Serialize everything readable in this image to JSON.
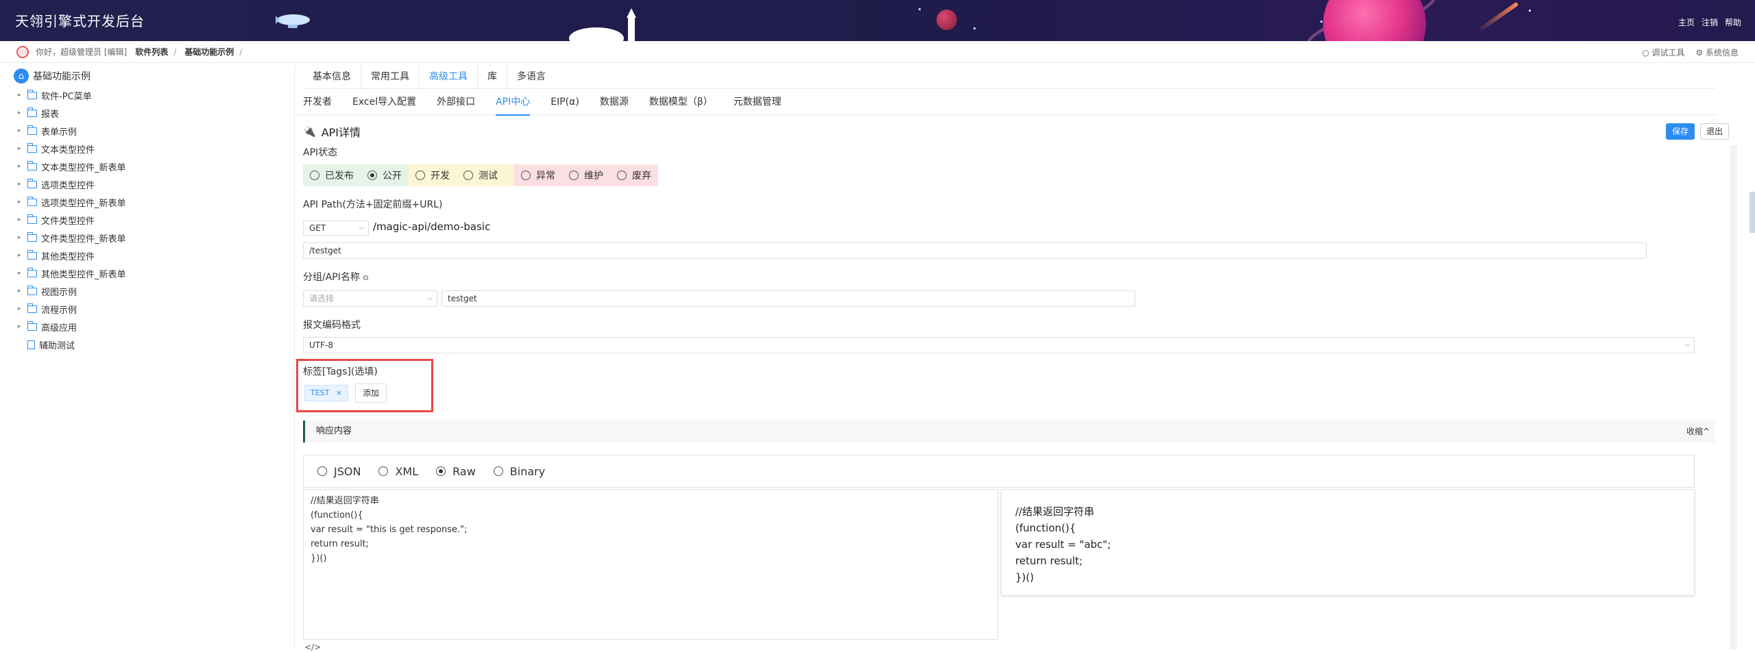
{
  "header": {
    "title": "天翎引擎式开发后台",
    "nav": [
      "主页",
      "注销",
      "帮助"
    ]
  },
  "breadcrumb": {
    "greeting": "你好，超级管理员 [编辑]",
    "items": [
      "软件列表",
      "基础功能示例"
    ],
    "separator": "/",
    "tools": [
      "调试工具",
      "系统信息"
    ]
  },
  "sidebar": {
    "root": "基础功能示例",
    "items": [
      {
        "label": "软件-PC菜单",
        "type": "folder"
      },
      {
        "label": "报表",
        "type": "folder"
      },
      {
        "label": "表单示例",
        "type": "folder"
      },
      {
        "label": "文本类型控件",
        "type": "folder"
      },
      {
        "label": "文本类型控件_新表单",
        "type": "folder"
      },
      {
        "label": "选项类型控件",
        "type": "folder"
      },
      {
        "label": "选项类型控件_新表单",
        "type": "folder"
      },
      {
        "label": "文件类型控件",
        "type": "folder"
      },
      {
        "label": "文件类型控件_新表单",
        "type": "folder"
      },
      {
        "label": "其他类型控件",
        "type": "folder"
      },
      {
        "label": "其他类型控件_新表单",
        "type": "folder"
      },
      {
        "label": "视图示例",
        "type": "folder"
      },
      {
        "label": "流程示例",
        "type": "folder"
      },
      {
        "label": "高级应用",
        "type": "folder"
      },
      {
        "label": "辅助测试",
        "type": "file"
      }
    ]
  },
  "tabs_primary": {
    "items": [
      "基本信息",
      "常用工具",
      "高级工具",
      "库",
      "多语言"
    ],
    "active": "高级工具"
  },
  "tabs_secondary": {
    "items": [
      "开发者",
      "Excel导入配置",
      "外部接口",
      "API中心",
      "EIP(α)",
      "数据源",
      "数据模型（β）",
      "元数据管理"
    ],
    "active": "API中心"
  },
  "detail": {
    "title": "API详情",
    "save": "保存",
    "exit": "退出",
    "status_label": "API状态",
    "statuses": [
      {
        "label": "已发布",
        "selected": false,
        "group": "green"
      },
      {
        "label": "公开",
        "selected": true,
        "group": "green"
      },
      {
        "label": "开发",
        "selected": false,
        "group": "yellow"
      },
      {
        "label": "测试",
        "selected": false,
        "group": "yellow"
      },
      {
        "label": "异常",
        "selected": false,
        "group": "pink"
      },
      {
        "label": "维护",
        "selected": false,
        "group": "pink"
      },
      {
        "label": "废弃",
        "selected": false,
        "group": "pink"
      }
    ],
    "path_label": "API Path(方法+固定前缀+URL)",
    "method": "GET",
    "prefix": "/magic-api/demo-basic",
    "path_value": "/testget",
    "group_label": "分组/API名称",
    "group_placeholder": "请选择",
    "api_name": "testget",
    "encoding_label": "报文编码格式",
    "encoding": "UTF-8",
    "tags_label": "标签[Tags](选填)",
    "tags": [
      "TEST"
    ],
    "add_tag": "添加",
    "response_label": "响应内容",
    "collapse": "收缩^",
    "formats": [
      {
        "label": "JSON",
        "selected": false
      },
      {
        "label": "XML",
        "selected": false
      },
      {
        "label": "Raw",
        "selected": true
      },
      {
        "label": "Binary",
        "selected": false
      }
    ],
    "code_left": "//结果返回字符串\n(function(){\nvar result = \"this is get response.\";\nreturn result;\n})()",
    "code_right": "//结果返回字符串\n(function(){\nvar result = \"abc\";\nreturn result;\n})()",
    "bottom_mark": "</>"
  },
  "colors": {
    "accent": "#2d8cf0",
    "header_bg": "#22204f",
    "highlight_box": "#e64747"
  }
}
